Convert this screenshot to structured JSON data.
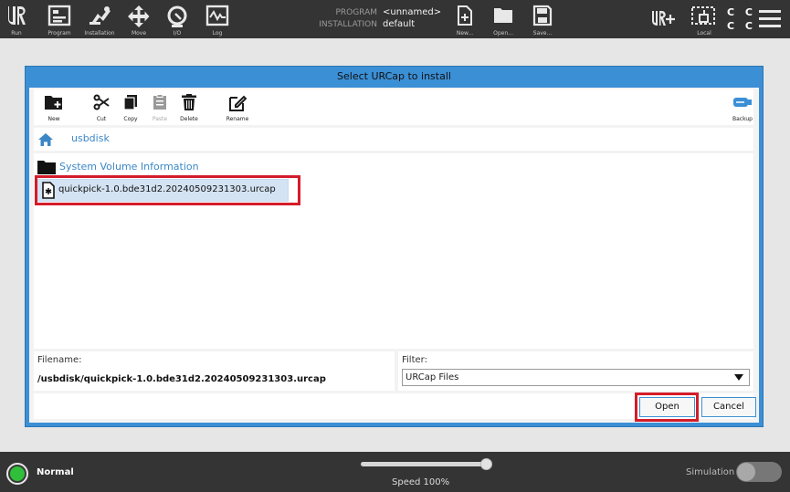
{
  "topbar": {
    "nav": [
      {
        "label": "Run",
        "icon": "ur-logo-icon"
      },
      {
        "label": "Program",
        "icon": "program-icon"
      },
      {
        "label": "Installation",
        "icon": "installation-icon"
      },
      {
        "label": "Move",
        "icon": "move-icon"
      },
      {
        "label": "I/O",
        "icon": "io-icon"
      },
      {
        "label": "Log",
        "icon": "log-icon"
      }
    ],
    "program_key": "PROGRAM",
    "program_value": "<unnamed>",
    "installation_key": "INSTALLATION",
    "installation_value": "default",
    "file_buttons": [
      {
        "label": "New...",
        "icon": "new-file-icon"
      },
      {
        "label": "Open...",
        "icon": "open-folder-icon"
      },
      {
        "label": "Save...",
        "icon": "save-icon"
      }
    ],
    "local_label": "Local",
    "cc_label": "C C\nC C"
  },
  "dialog": {
    "title": "Select URCap to install",
    "toolbar": {
      "new": "New",
      "cut": "Cut",
      "copy": "Copy",
      "paste": "Paste",
      "delete": "Delete",
      "rename": "Rename",
      "backup": "Backup"
    },
    "path": "usbdisk",
    "folders": [
      "System Volume Information"
    ],
    "files": [
      "quickpick-1.0.bde31d2.20240509231303.urcap"
    ],
    "filename_label": "Filename:",
    "filename_value": "/usbdisk/quickpick-1.0.bde31d2.20240509231303.urcap",
    "filter_label": "Filter:",
    "filter_value": "URCap Files",
    "open_label": "Open",
    "cancel_label": "Cancel"
  },
  "bottombar": {
    "status": "Normal",
    "speed": "Speed 100%",
    "speed_fraction": 1.0,
    "simulation_label": "Simulation"
  },
  "colors": {
    "accent": "#3b8fd5",
    "highlight": "#d41c2a",
    "status_ok": "#2fbf3a"
  }
}
